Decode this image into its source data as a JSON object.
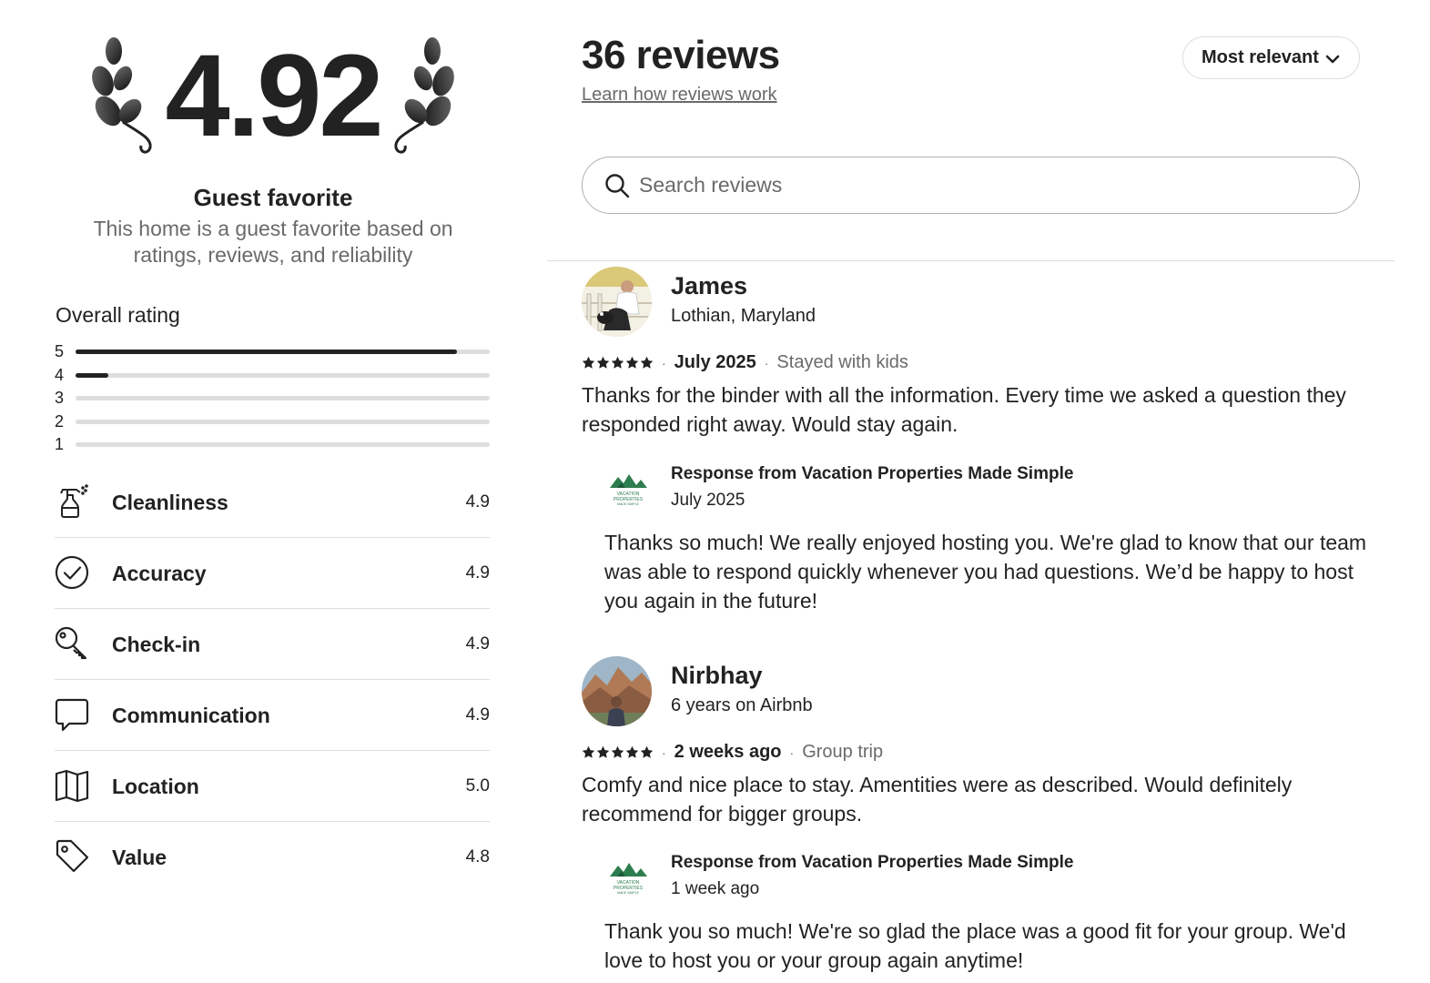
{
  "summary": {
    "rating": "4.92",
    "badge_title": "Guest favorite",
    "badge_description": "This home is a guest favorite based on ratings, reviews, and reliability"
  },
  "overall": {
    "title": "Overall rating",
    "distribution": [
      {
        "stars": "5",
        "fraction": 0.92
      },
      {
        "stars": "4",
        "fraction": 0.08
      },
      {
        "stars": "3",
        "fraction": 0
      },
      {
        "stars": "2",
        "fraction": 0
      },
      {
        "stars": "1",
        "fraction": 0
      }
    ]
  },
  "categories": [
    {
      "label": "Cleanliness",
      "score": "4.9",
      "icon": "spray-bottle-icon"
    },
    {
      "label": "Accuracy",
      "score": "4.9",
      "icon": "check-circle-icon"
    },
    {
      "label": "Check-in",
      "score": "4.9",
      "icon": "key-icon"
    },
    {
      "label": "Communication",
      "score": "4.9",
      "icon": "chat-bubble-icon"
    },
    {
      "label": "Location",
      "score": "5.0",
      "icon": "map-icon"
    },
    {
      "label": "Value",
      "score": "4.8",
      "icon": "price-tag-icon"
    }
  ],
  "header": {
    "count_title": "36 reviews",
    "learn_link": "Learn how reviews work",
    "sort_label": "Most relevant"
  },
  "search": {
    "placeholder": "Search reviews"
  },
  "reviews": [
    {
      "name": "James",
      "subtitle": "Lothian, Maryland",
      "stars": 5,
      "date": "July 2025",
      "trip_type": "Stayed with kids",
      "text": "Thanks for the binder with all the information.  Every time we asked a question they responded right away. Would stay again.",
      "response": {
        "from": "Response from Vacation Properties Made Simple",
        "date": "July 2025",
        "text": "Thanks so much! We really enjoyed hosting you. We're glad to know that our team was able to respond quickly whenever you had questions. We’d be happy to host you again in the future!"
      }
    },
    {
      "name": "Nirbhay",
      "subtitle": "6 years on Airbnb",
      "stars": 5,
      "date": "2 weeks ago",
      "trip_type": "Group trip",
      "text": "Comfy and nice place to stay. Amentities were as described. Would definitely recommend for bigger groups.",
      "response": {
        "from": "Response from Vacation Properties Made Simple",
        "date": "1 week ago",
        "text": "Thank you so much! We're so glad the place was a good fit for your group. We'd love to host you or your group again anytime!"
      }
    }
  ],
  "colors": {
    "text": "#222222",
    "muted": "#6a6a6a",
    "border": "#dddddd",
    "host_green": "#2e7d4f"
  }
}
